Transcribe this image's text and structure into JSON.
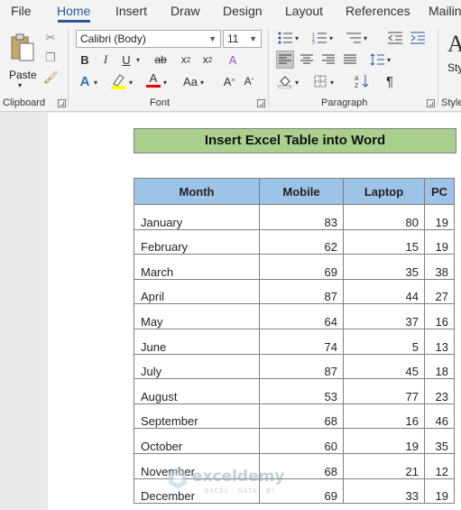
{
  "tabs": [
    "File",
    "Home",
    "Insert",
    "Draw",
    "Design",
    "Layout",
    "References",
    "Mailin"
  ],
  "active_tab": "Home",
  "ribbon": {
    "clipboard": {
      "label": "Clipboard",
      "paste_label": "Paste"
    },
    "font": {
      "label": "Font",
      "font_name": "Calibri (Body)",
      "font_size": "11"
    },
    "paragraph": {
      "label": "Paragraph"
    },
    "styles": {
      "label": "Styles",
      "btn_label": "Sty"
    }
  },
  "document": {
    "title": "Insert Excel Table into Word",
    "table": {
      "headers": [
        "Month",
        "Mobile",
        "Laptop",
        "PC"
      ],
      "rows": [
        [
          "January",
          "83",
          "80",
          "19"
        ],
        [
          "February",
          "62",
          "15",
          "19"
        ],
        [
          "March",
          "69",
          "35",
          "38"
        ],
        [
          "April",
          "87",
          "44",
          "27"
        ],
        [
          "May",
          "64",
          "37",
          "16"
        ],
        [
          "June",
          "74",
          "5",
          "13"
        ],
        [
          "July",
          "87",
          "45",
          "18"
        ],
        [
          "August",
          "53",
          "77",
          "23"
        ],
        [
          "September",
          "68",
          "16",
          "46"
        ],
        [
          "October",
          "60",
          "19",
          "35"
        ],
        [
          "November",
          "68",
          "21",
          "12"
        ],
        [
          "December",
          "69",
          "33",
          "19"
        ]
      ]
    }
  },
  "watermark": {
    "name": "exceldemy",
    "tagline": "EXCEL · DATA · BI"
  },
  "colors": {
    "accent": "#2b579a",
    "title_fill": "#a9d08e",
    "header_fill": "#9dc3e6"
  }
}
